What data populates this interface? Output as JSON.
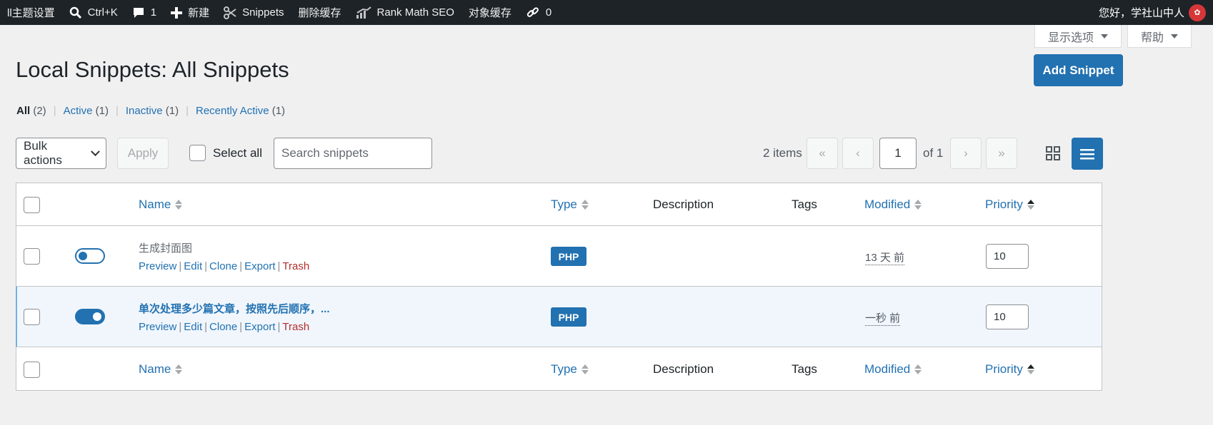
{
  "adminbar": {
    "theme_settings": "ll主题设置",
    "search_shortcut": "Ctrl+K",
    "comments_count": "1",
    "new_label": "新建",
    "snippets_label": "Snippets",
    "clear_cache": "删除缓存",
    "rank_math": "Rank Math SEO",
    "object_cache": "对象缓存",
    "links_count": "0",
    "greeting": "您好，学社山中人"
  },
  "screen_meta": {
    "screen_options": "显示选项",
    "help": "帮助"
  },
  "page": {
    "title": "Local Snippets: All Snippets",
    "add_button": "Add Snippet"
  },
  "filters": [
    {
      "label": "All",
      "count": "(2)"
    },
    {
      "label": "Active",
      "count": "(1)"
    },
    {
      "label": "Inactive",
      "count": "(1)"
    },
    {
      "label": "Recently Active",
      "count": "(1)"
    }
  ],
  "toolbar": {
    "bulk_actions": "Bulk actions",
    "apply": "Apply",
    "select_all": "Select all",
    "search_placeholder": "Search snippets",
    "items_count": "2 items",
    "first": "«",
    "prev": "‹",
    "page": "1",
    "of_pages": "of 1",
    "next": "›",
    "last": "»"
  },
  "columns": {
    "name": "Name",
    "type": "Type",
    "description": "Description",
    "tags": "Tags",
    "modified": "Modified",
    "priority": "Priority"
  },
  "rows": [
    {
      "name": "生成封面图",
      "active": false,
      "type": "PHP",
      "modified": "13 天 前",
      "priority": "10"
    },
    {
      "name": "单次处理多少篇文章，按照先后顺序，...",
      "active": true,
      "type": "PHP",
      "modified": "一秒 前",
      "priority": "10"
    }
  ],
  "row_actions": {
    "preview": "Preview",
    "edit": "Edit",
    "clone": "Clone",
    "export": "Export",
    "trash": "Trash"
  },
  "colors": {
    "primary": "#2271b1",
    "trash": "#b32d2e",
    "adminbar": "#1d2327"
  }
}
